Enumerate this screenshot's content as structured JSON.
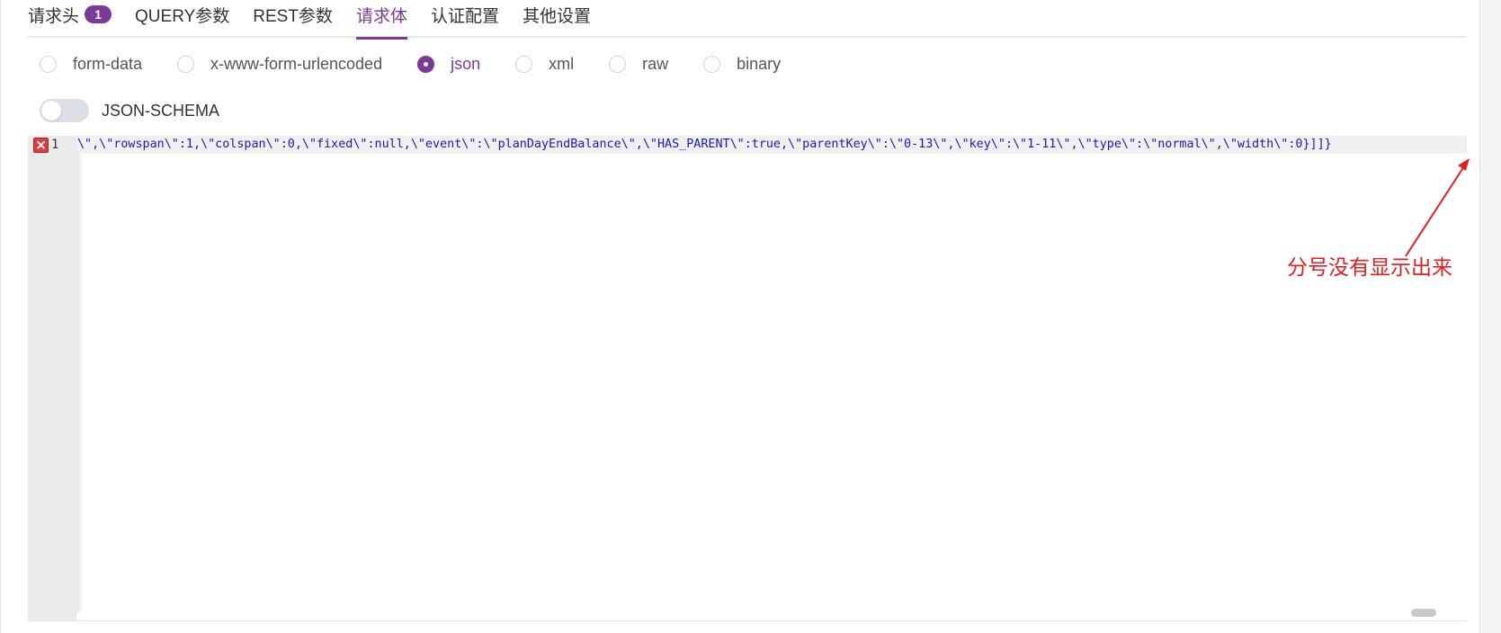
{
  "tabs": [
    {
      "label": "请求头",
      "badge": "1"
    },
    {
      "label": "QUERY参数"
    },
    {
      "label": "REST参数"
    },
    {
      "label": "请求体"
    },
    {
      "label": "认证配置"
    },
    {
      "label": "其他设置"
    }
  ],
  "body_types": [
    "form-data",
    "x-www-form-urlencoded",
    "json",
    "xml",
    "raw",
    "binary"
  ],
  "selected_body_type": "json",
  "schema_toggle": {
    "label": "JSON-SCHEMA",
    "enabled": false
  },
  "editor": {
    "line_number": "1",
    "error_marker": "×",
    "code": "\\\",\\\"rowspan\\\":1,\\\"colspan\\\":0,\\\"fixed\\\":null,\\\"event\\\":\\\"planDayEndBalance\\\",\\\"HAS_PARENT\\\":true,\\\"parentKey\\\":\\\"0-13\\\",\\\"key\\\":\\\"1-11\\\",\\\"type\\\":\\\"normal\\\",\\\"width\\\":0}]]}"
  },
  "annotation": {
    "text": "分号没有显示出来",
    "color": "#e02020"
  },
  "colors": {
    "accent": "#7b3a96",
    "code_text": "#1a1ab8"
  }
}
